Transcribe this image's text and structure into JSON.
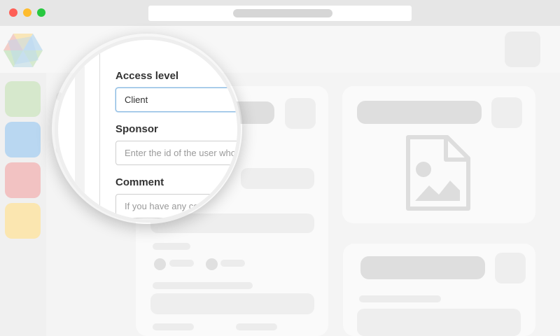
{
  "window": {
    "controls": [
      "close",
      "minimize",
      "maximize"
    ],
    "colors": {
      "close": "#fe5f57",
      "minimize": "#febc2e",
      "maximize": "#28c840"
    }
  },
  "sidebar": {
    "tiles": [
      {
        "name": "green",
        "color": "#d6e8cc"
      },
      {
        "name": "blue",
        "color": "#b9d7f1"
      },
      {
        "name": "red",
        "color": "#f2c2c2"
      },
      {
        "name": "yellow",
        "color": "#fbe6b0"
      }
    ]
  },
  "logo": {
    "colors": [
      "#f3c9c4",
      "#c6dff2",
      "#cfe7c9",
      "#fbe4b3"
    ]
  },
  "form": {
    "access_level": {
      "label": "Access level",
      "value": "Client"
    },
    "sponsor": {
      "label": "Sponsor",
      "placeholder": "Enter the id of the user who"
    },
    "comment": {
      "label": "Comment",
      "placeholder": "If you have any comments"
    }
  },
  "image_placeholder": {
    "icon": "image-file-icon"
  }
}
